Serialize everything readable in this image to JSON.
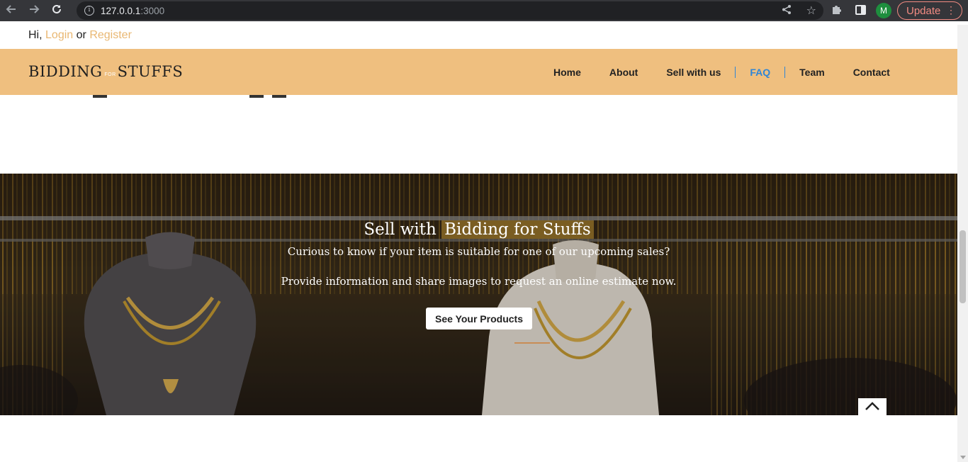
{
  "browser": {
    "url_host": "127.0.0.1",
    "url_port": ":3000",
    "update_label": "Update",
    "profile_initial": "M"
  },
  "topbar": {
    "greeting": "Hi,",
    "login": "Login",
    "or": "or",
    "register": "Register"
  },
  "logo": {
    "part1": "BIDDING",
    "part2": "FOR",
    "part3": "STUFFS"
  },
  "nav": {
    "items": [
      {
        "label": "Home"
      },
      {
        "label": "About"
      },
      {
        "label": "Sell with us"
      },
      {
        "label": "FAQ"
      },
      {
        "label": "Team"
      },
      {
        "label": "Contact"
      }
    ],
    "active": "FAQ",
    "active_color": "#2f86d6"
  },
  "hero": {
    "title_prefix": "Sell with",
    "title_highlight": "Bidding for Stuffs",
    "line1": "Curious to know if your item is suitable for one of our upcoming sales?",
    "line2": "Provide information and share images to request an online estimate now.",
    "button_label": "See Your Products"
  },
  "colors": {
    "header_bg": "#efbf7f",
    "link": "#e9b772",
    "highlight": "#7a5d22"
  },
  "icons": {
    "back": "arrow-left-icon",
    "forward": "arrow-right-icon",
    "reload": "reload-icon",
    "info": "info-icon",
    "share": "share-icon",
    "bookmark": "star-icon",
    "extensions": "puzzle-icon",
    "side_panel": "side-panel-icon",
    "scroll_top": "chevron-up-icon"
  }
}
